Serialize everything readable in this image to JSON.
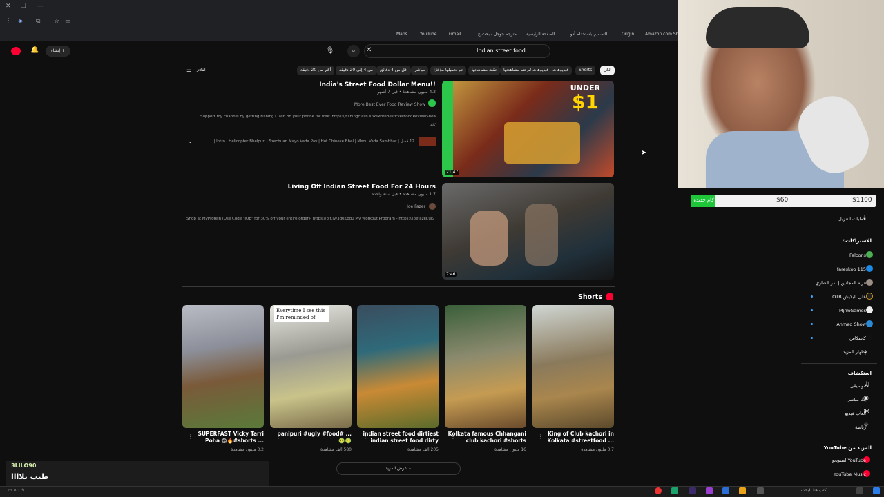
{
  "browser": {
    "bookmarks": [
      "Amazon.com Sho",
      "Origin",
      "التصميم باستخدام أدو...",
      "الصفحة الرئيسية",
      "مترجم جوجل - بحث ج...",
      "Gmail",
      "YouTube",
      "Maps"
    ]
  },
  "header": {
    "create_label": "إنشاء",
    "search_query": "Indian street food"
  },
  "filters": {
    "label": "الفلاتر",
    "chips": [
      "الكل",
      "Shorts",
      "فيديوهات",
      "فيديوهات لم تتم مشاهدتها",
      "تمّت مشاهدتها",
      "تم تحميلها مؤخرًا",
      "مباشر",
      "أقل من 4 دقائق",
      "من 4 إلى 20 دقيقة",
      "أكثر من 20 دقيقة"
    ]
  },
  "videos": [
    {
      "title": "India's Street Food Dollar Menu!!",
      "meta": "4.2 مليون مشاهدة • قبل 7 أشهر",
      "channel": "More Best Ever Food Review Show",
      "description": "Support my channel by getting Fishing Clash on your phone for free: https://fishingclash.link/MoreBestEverFoodReviewShow!",
      "badge": "4K",
      "chapters": "12 فصل | Intro | Helicopter Bhelpuri | Szechuan Mayo Vada Pav | Hot Chinese Bhel | Medu Vada Sambhar | ...",
      "duration": "21:47",
      "thumb_text_1": "UNDER",
      "thumb_text_2": "$1"
    },
    {
      "title": "Living Off Indian Street Food For 24 Hours",
      "meta": "1.7 مليون مشاهدة • قبل سنة واحدة",
      "channel": "Joe Fazer",
      "description": "Shop at MyProtein (Use Code \"JOE\" for 30% off your entire order)- https://bit.ly/3d0Zod0 My Workout Program - https://joefazer.uk/ ...",
      "duration": "7:46"
    }
  ],
  "shorts": {
    "heading": "Shorts",
    "show_more": "عرض المزيد",
    "items": [
      {
        "title": "King of Club kachori in Kolkata #streetfood ...",
        "views": "3.7 مليون مشاهدة"
      },
      {
        "title": "Kolkata famous Chhangani club kachori #shorts",
        "views": "16 مليون مشاهدة"
      },
      {
        "title": "indian street food dirtiest indian street food dirty",
        "views": "205 ألف مشاهدة"
      },
      {
        "title": "panipuri #ugly #food# ... 🤢🤢",
        "views": "580 ألف مشاهدة",
        "overlay": "Everytime I see this I'm reminded of"
      },
      {
        "title": "SUPERFAST Vicky Tarri Poha 😱🔥#shorts ...",
        "views": "3.2 مليون مشاهدة"
      }
    ]
  },
  "stream_overlay": {
    "donation_left": "كام جديده",
    "donation_mid": "$60",
    "donation_goal": "$1100",
    "chat_user": "3LILO90",
    "chat_message": "طيب يلاااا"
  },
  "sidebar": {
    "downloads": "عمليات التنزيل",
    "subs_heading": "الاشتراكات",
    "subs": [
      "Falcons",
      "fareskoo 115",
      "قرية المجانين | بدر الشاري",
      "على البلايش OTB",
      "MjrmGames",
      "Ahmed Show",
      "كاسكاس",
      "إظهار المزيد"
    ],
    "explore_heading": "استكشاف",
    "explore": [
      "موسيقى",
      "بث مباشر",
      "ألعاب فيديو",
      "رياضة"
    ],
    "more_heading": "المزيد من YouTube",
    "more": [
      "YouTube استوديو",
      "YouTube Music"
    ]
  },
  "taskbar": {
    "search_placeholder": "اكتب هنا للبحث"
  }
}
